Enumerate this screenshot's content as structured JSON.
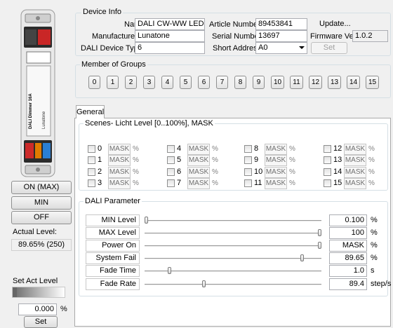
{
  "device_info": {
    "title": "Device Info",
    "name_label": "Name",
    "name_value": "DALI CW-WW LED D...",
    "manufacturer_label": "Manufacturer",
    "manufacturer_value": "Lunatone",
    "type_label": "DALI Device Type",
    "type_value": "6",
    "article_label": "Article Number",
    "article_value": "89453841",
    "serial_label": "Serial Number",
    "serial_value": "13697",
    "short_address_label": "Short Address",
    "short_address_value": "A0",
    "update_label": "Update...",
    "firmware_label": "Firmware Ver",
    "firmware_value": "1.0.2",
    "set_label": "Set"
  },
  "groups": {
    "title": "Member of Groups",
    "items": [
      "0",
      "1",
      "2",
      "3",
      "4",
      "5",
      "6",
      "7",
      "8",
      "9",
      "10",
      "11",
      "12",
      "13",
      "14",
      "15"
    ]
  },
  "left_panel": {
    "on_label": "ON (MAX)",
    "min_label": "MIN",
    "off_label": "OFF",
    "actual_level_label": "Actual Level:",
    "actual_level_value": "89.65% (250)",
    "set_act_level_label": "Set Act Level",
    "set_value": "0.000",
    "set_unit": "%",
    "set_button": "Set"
  },
  "tabs": [
    "General"
  ],
  "scenes": {
    "title": "Scenes- Licht Level [0..100%], MASK",
    "mask_text": "MASK",
    "pct_text": "%",
    "items": [
      {
        "num": "0",
        "value": "MASK"
      },
      {
        "num": "1",
        "value": "MASK"
      },
      {
        "num": "2",
        "value": "MASK"
      },
      {
        "num": "3",
        "value": "MASK"
      },
      {
        "num": "4",
        "value": "MASK"
      },
      {
        "num": "5",
        "value": "MASK"
      },
      {
        "num": "6",
        "value": "MASK"
      },
      {
        "num": "7",
        "value": "MASK"
      },
      {
        "num": "8",
        "value": "MASK"
      },
      {
        "num": "9",
        "value": "MASK"
      },
      {
        "num": "10",
        "value": "MASK"
      },
      {
        "num": "11",
        "value": "MASK"
      },
      {
        "num": "12",
        "value": "MASK"
      },
      {
        "num": "13",
        "value": "MASK"
      },
      {
        "num": "14",
        "value": "MASK"
      },
      {
        "num": "15",
        "value": "MASK"
      }
    ]
  },
  "dali_parameter": {
    "title": "DALI Parameter",
    "rows": [
      {
        "label": "MIN Level",
        "value": "0.100",
        "unit": "%",
        "fraction": 0.0
      },
      {
        "label": "MAX Level",
        "value": "100",
        "unit": "%",
        "fraction": 1.0
      },
      {
        "label": "Power On Level",
        "value": "MASK",
        "unit": "%",
        "fraction": 1.0
      },
      {
        "label": "System Fail Level",
        "value": "89.65",
        "unit": "%",
        "fraction": 0.9
      },
      {
        "label": "Fade Time",
        "value": "1.0",
        "unit": "s",
        "fraction": 0.133
      },
      {
        "label": "Fade Rate",
        "value": "89.4",
        "unit": "step/s",
        "fraction": 0.333
      }
    ]
  },
  "device_image": {
    "label": "DALI Dimmer 16A",
    "brand": "Lunatone",
    "connector_colors": [
      "#333333",
      "#d62828",
      "#e07b00",
      "#2a7fd4"
    ]
  }
}
